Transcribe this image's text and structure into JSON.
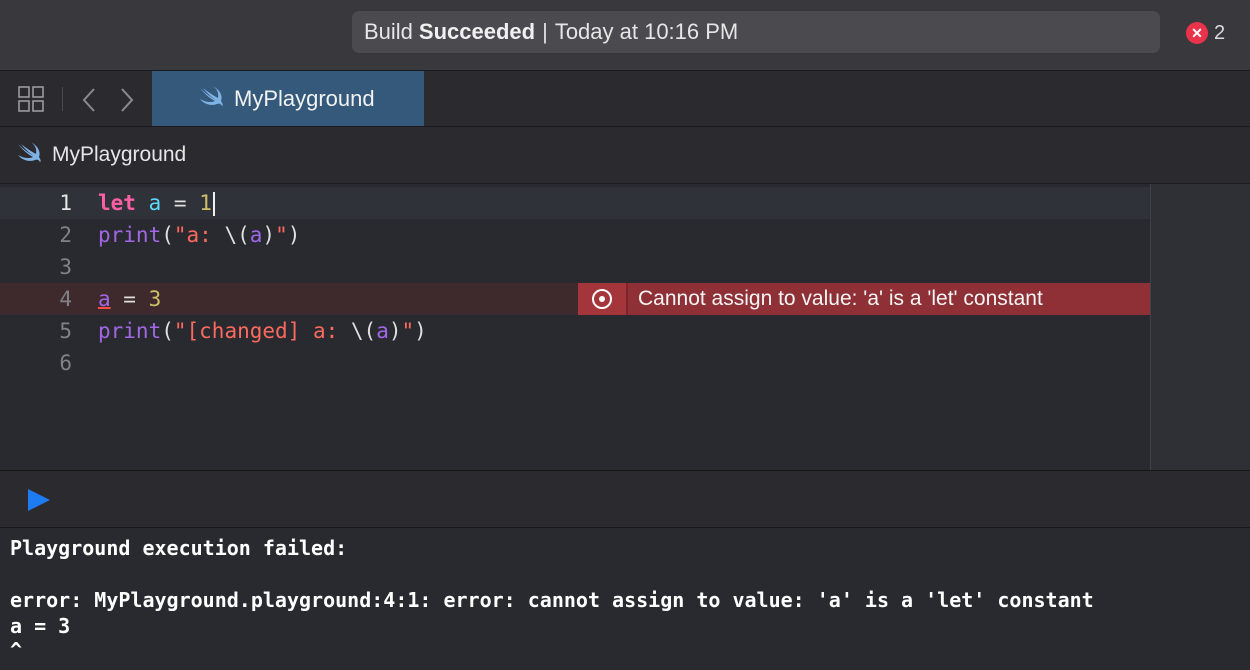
{
  "toolbar": {
    "activity_prefix": "Build",
    "activity_status": "Succeeded",
    "activity_separator": "|",
    "activity_time": "Today at 10:16 PM",
    "error_count": "2"
  },
  "tab": {
    "label": "MyPlayground"
  },
  "jumpbar": {
    "label": "MyPlayground"
  },
  "editor": {
    "line_numbers": [
      "1",
      "2",
      "3",
      "4",
      "5",
      "6"
    ],
    "error_message": "Cannot assign to value: 'a' is a 'let' constant"
  },
  "console": {
    "lines": [
      "Playground execution failed:",
      "",
      "error: MyPlayground.playground:4:1: error: cannot assign to value: 'a' is a 'let' constant",
      "a = 3",
      "^"
    ]
  },
  "colors": {
    "keyword": "#fc5fa3",
    "variable": "#5dd8ff",
    "number": "#d0bf69",
    "function": "#a167e6",
    "string": "#fc6a5d",
    "error_bg": "#8e3035",
    "tab_bg": "#34597b"
  },
  "icons": {
    "grid": "grid-icon",
    "back": "chevron-left-icon",
    "forward": "chevron-right-icon",
    "swift": "swift-icon",
    "error": "error-circle-icon",
    "play": "play-icon"
  }
}
